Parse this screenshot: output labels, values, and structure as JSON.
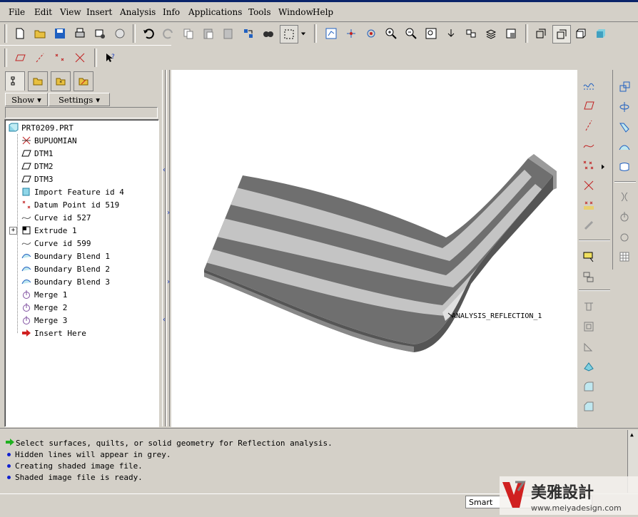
{
  "menu": [
    "File",
    "Edit",
    "View",
    "Insert",
    "Analysis",
    "Info",
    "Applications",
    "Tools",
    "Window",
    "Help"
  ],
  "nav": {
    "show_label": "Show",
    "settings_label": "Settings"
  },
  "tree": [
    {
      "label": "PRT0209.PRT",
      "icon": "part-icon"
    },
    {
      "label": "BUPUOMIAN",
      "icon": "datum-plane-x-icon"
    },
    {
      "label": "DTM1",
      "icon": "datum-plane-icon"
    },
    {
      "label": "DTM2",
      "icon": "datum-plane-icon"
    },
    {
      "label": "DTM3",
      "icon": "datum-plane-icon"
    },
    {
      "label": "Import Feature id 4",
      "icon": "import-icon"
    },
    {
      "label": "Datum Point id 519",
      "icon": "datum-point-icon"
    },
    {
      "label": "Curve id 527",
      "icon": "curve-icon"
    },
    {
      "label": "Extrude 1",
      "icon": "extrude-icon"
    },
    {
      "label": "Curve id 599",
      "icon": "curve-icon"
    },
    {
      "label": "Boundary Blend 1",
      "icon": "boundary-blend-icon"
    },
    {
      "label": "Boundary Blend 2",
      "icon": "boundary-blend-icon"
    },
    {
      "label": "Boundary Blend 3",
      "icon": "boundary-blend-icon"
    },
    {
      "label": "Merge 1",
      "icon": "merge-icon"
    },
    {
      "label": "Merge 2",
      "icon": "merge-icon"
    },
    {
      "label": "Merge 3",
      "icon": "merge-icon"
    },
    {
      "label": "Insert Here",
      "icon": "insert-arrow-icon"
    }
  ],
  "graphics": {
    "annotation": "ANALYSIS_REFLECTION_1"
  },
  "messages": [
    {
      "text": "Select surfaces, quilts, or solid geometry for Reflection analysis.",
      "bullet": "green-arrow"
    },
    {
      "text": "Hidden lines will appear in grey.",
      "bullet": "blue-dot"
    },
    {
      "text": "Creating shaded image file.",
      "bullet": "blue-dot"
    },
    {
      "text": "Shaded image file is ready.",
      "bullet": "blue-dot"
    }
  ],
  "status": {
    "filter_value": "Smart"
  },
  "watermark": {
    "brand": "美雅設計",
    "url": "www.meiyadesign.com"
  },
  "colors": {
    "background": "#d4d0c8",
    "title_bar": "#0a246a",
    "shaded_dark": "#707070",
    "shaded_light": "#c8c8c8",
    "icon_blue": "#2060c0",
    "icon_red": "#c02020"
  }
}
